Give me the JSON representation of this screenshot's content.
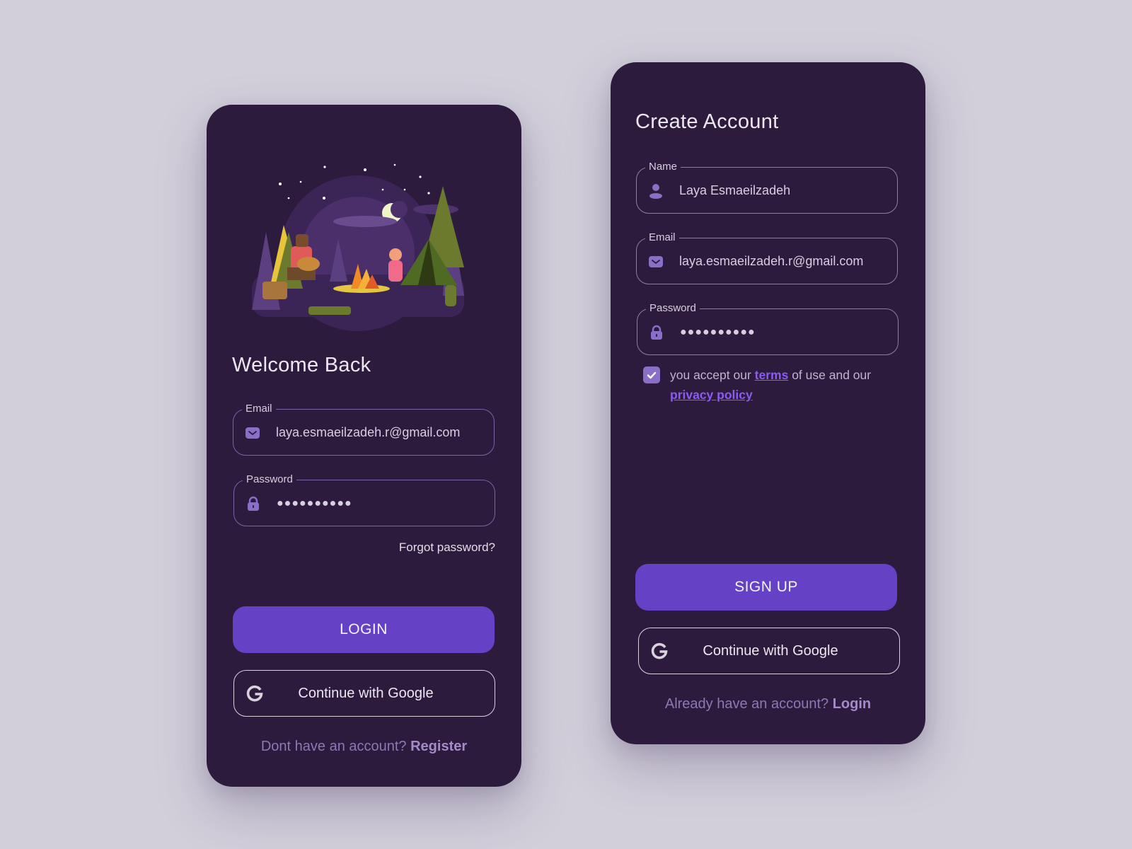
{
  "login": {
    "title": "Welcome Back",
    "illustration": "campfire-night-scene",
    "email": {
      "label": "Email",
      "value": "laya.esmaeilzadeh.r@gmail.com",
      "icon": "mail-icon"
    },
    "password": {
      "label": "Password",
      "value": "●●●●●●●●●●",
      "icon": "lock-icon"
    },
    "forgot_password": "Forgot password?",
    "login_button": "LOGIN",
    "google_button": "Continue with Google",
    "footer_prompt": "Dont have an account?",
    "footer_link": "Register"
  },
  "signup": {
    "title": "Create Account",
    "name": {
      "label": "Name",
      "value": "Laya Esmaeilzadeh",
      "icon": "user-icon"
    },
    "email": {
      "label": "Email",
      "value": "laya.esmaeilzadeh.r@gmail.com",
      "icon": "mail-icon"
    },
    "password": {
      "label": "Password",
      "value": "●●●●●●●●●●",
      "icon": "lock-icon"
    },
    "terms": {
      "checked": true,
      "prefix": "you accept our ",
      "terms_link": "terms",
      "middle": " of use and our ",
      "privacy_link": "privacy policy"
    },
    "signup_button": "SIGN UP",
    "google_button": "Continue with Google",
    "footer_prompt": "Already have an account?",
    "footer_link": "Login"
  },
  "colors": {
    "background": "#d2cfda",
    "card": "#2d1b3e",
    "accent": "#6541c6",
    "icon": "#8a6fc8",
    "link": "#8a5cf0"
  }
}
